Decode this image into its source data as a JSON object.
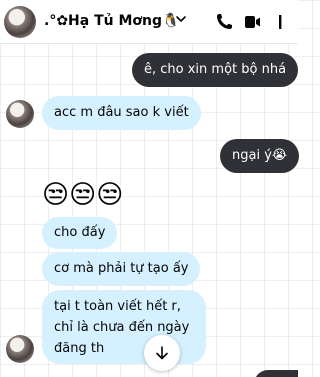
{
  "header": {
    "contact_name": ".°✿Hạ Tủ Mơng🐧",
    "icons": [
      "dropdown-chevron",
      "phone-icon",
      "video-icon",
      "info-menu-icon"
    ]
  },
  "messages": {
    "m1": "ê, cho xin một bộ nhá",
    "m2": "acc m đâu sao k viết",
    "m3": "ngại ý😭",
    "m4_emoji": "😒😒😒",
    "m5": "cho đấy",
    "m6": "cơ mà phải tự tạo ấy",
    "m7": "tại t toàn viết hết r, chỉ là chưa đến ngày đăng th"
  },
  "colors": {
    "incoming_bubble": "#d5f0ff",
    "outgoing_bubble": "#303136",
    "icon": "#050505"
  }
}
